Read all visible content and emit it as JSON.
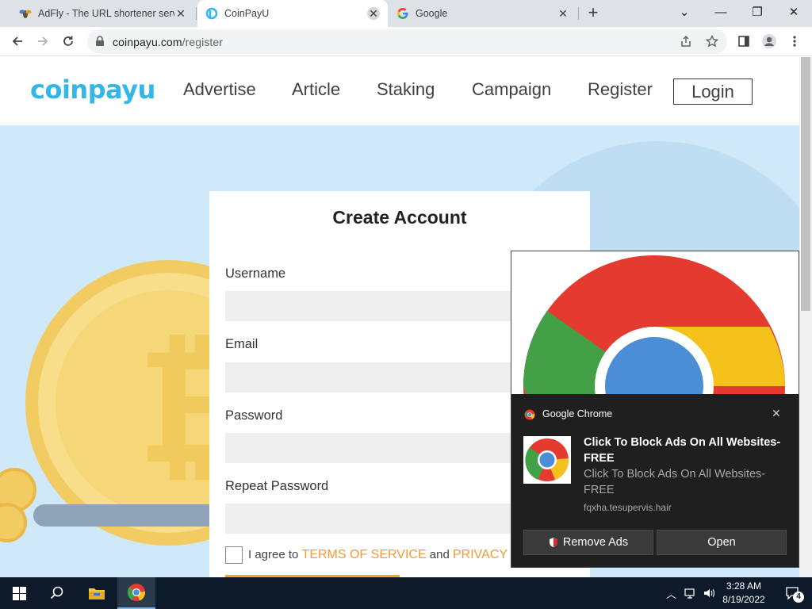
{
  "browser": {
    "tabs": [
      {
        "title": "AdFly - The URL shortener service",
        "active": false
      },
      {
        "title": "CoinPayU",
        "active": true
      },
      {
        "title": "Google",
        "active": false
      }
    ],
    "new_tab": "+",
    "window_controls": {
      "menu": "⌄",
      "minimize": "—",
      "restore": "❐",
      "close": "✕"
    },
    "address": {
      "host": "coinpayu.com",
      "path": "/register"
    }
  },
  "site": {
    "logo": "coinpayu",
    "nav": [
      {
        "label": "Advertise"
      },
      {
        "label": "Article"
      },
      {
        "label": "Staking"
      },
      {
        "label": "Campaign"
      },
      {
        "label": "Register"
      }
    ],
    "login_label": "Login"
  },
  "form": {
    "title": "Create Account",
    "fields": [
      {
        "label": "Username",
        "value": ""
      },
      {
        "label": "Email",
        "value": ""
      },
      {
        "label": "Password",
        "value": ""
      },
      {
        "label": "Repeat Password",
        "value": ""
      }
    ],
    "agree": {
      "prefix": "I agree to ",
      "terms": "TERMS OF SERVICE",
      "and": " and ",
      "privacy": "PRIVACY P"
    }
  },
  "notification": {
    "app": "Google Chrome",
    "title": "Click To Block Ads On All Websites-FREE",
    "message": "Click To Block Ads On All Websites-FREE",
    "source": "fqxha.tesupervis.hair",
    "close": "✕",
    "buttons": {
      "remove": "Remove Ads",
      "open": "Open"
    }
  },
  "taskbar": {
    "clock": {
      "time": "3:28 AM",
      "date": "8/19/2022"
    },
    "notification_count": "4"
  },
  "colors": {
    "logo": "#34b7e8",
    "link_orange": "#f39a3a",
    "hero_bg": "#cfe9f8",
    "notif_bg": "#1f1f1f",
    "taskbar": "#0c1a29"
  }
}
